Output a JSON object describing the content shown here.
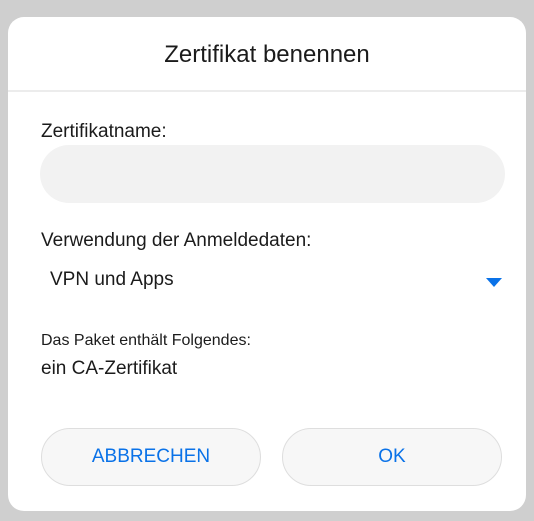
{
  "dialog": {
    "title": "Zertifikat benennen",
    "name_label": "Zertifikatname:",
    "name_value": "",
    "usage_label": "Verwendung der Anmeldedaten:",
    "usage_value": "VPN und Apps",
    "package_label": "Das Paket enthält Folgendes:",
    "package_value": "ein CA-Zertifikat",
    "cancel_label": "ABBRECHEN",
    "ok_label": "OK"
  },
  "icons": {
    "dropdown": "chevron-down-icon"
  },
  "colors": {
    "accent": "#0a72e8",
    "input_bg": "#f2f2f2",
    "text": "#1b1b1b"
  }
}
